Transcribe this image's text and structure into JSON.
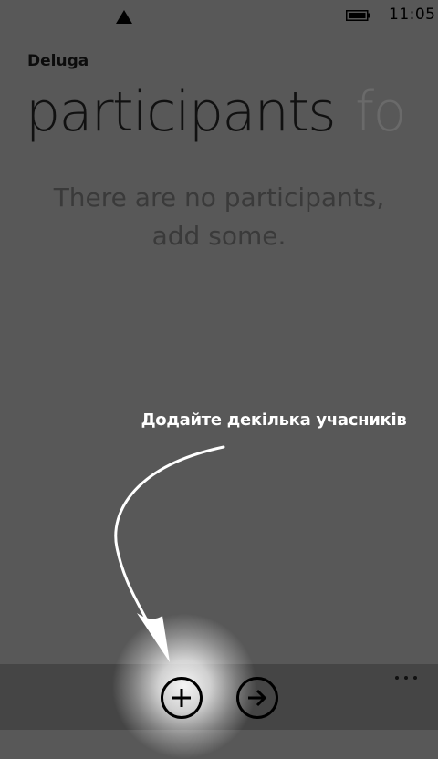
{
  "status": {
    "time": "11:05",
    "signal_icon": "signal-triangle-icon",
    "battery_icon": "battery-icon"
  },
  "app": {
    "title": "Deluga"
  },
  "pivot": {
    "items": [
      {
        "label": "participants"
      },
      {
        "label": "fo"
      }
    ]
  },
  "empty_state": {
    "line1": "There are no participants,",
    "line2": "add some."
  },
  "hint": {
    "text": "Додайте декілька учасників"
  },
  "app_bar": {
    "buttons": [
      {
        "icon": "plus-icon"
      },
      {
        "icon": "arrow-right-icon"
      }
    ],
    "more_icon": "ellipsis-icon"
  }
}
